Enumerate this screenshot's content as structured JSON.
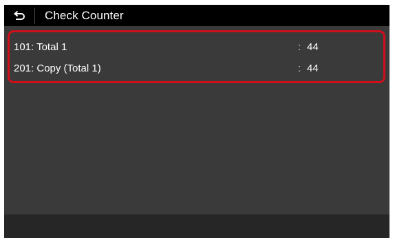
{
  "header": {
    "back_icon": "back-arrow-icon",
    "title": "Check Counter"
  },
  "counters": [
    {
      "label": "101: Total 1",
      "separator": ":",
      "value": "44"
    },
    {
      "label": "201: Copy (Total 1)",
      "separator": ":",
      "value": "44"
    }
  ],
  "colors": {
    "highlight_border": "#d10f1b",
    "title_bar": "#000000",
    "background": "#3a3a3a"
  }
}
